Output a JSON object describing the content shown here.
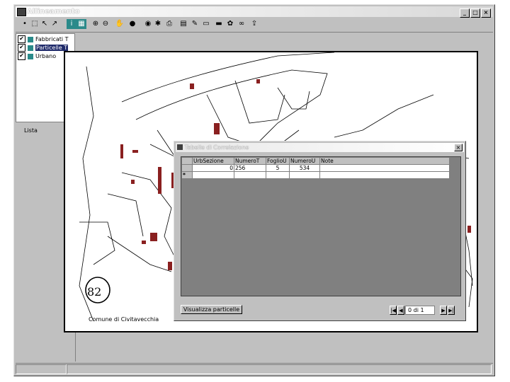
{
  "window": {
    "title": "Allineamento"
  },
  "caption_buttons": [
    "_",
    "□",
    "×"
  ],
  "toolbar": {
    "buttons": [
      {
        "name": "pointer-icon",
        "glyph": "•"
      },
      {
        "name": "zoom-window-icon",
        "glyph": "⬚"
      },
      {
        "name": "select-arrow-icon",
        "glyph": "↖"
      },
      {
        "name": "draw-icon",
        "glyph": "↗"
      },
      {
        "name": "identify-icon",
        "glyph": "i"
      },
      {
        "name": "layer-icon",
        "glyph": "▦"
      },
      {
        "name": "zoom-in-icon",
        "glyph": "⊕"
      },
      {
        "name": "zoom-out-icon",
        "glyph": "⊖"
      },
      {
        "name": "pan-hand-icon",
        "glyph": "✋"
      },
      {
        "name": "record-icon",
        "glyph": "●"
      },
      {
        "name": "globe-icon",
        "glyph": "◉"
      },
      {
        "name": "pin-icon",
        "glyph": "✱"
      },
      {
        "name": "print-icon",
        "glyph": "⎙"
      },
      {
        "name": "table-icon",
        "glyph": "▤"
      },
      {
        "name": "edit-icon",
        "glyph": "✎"
      },
      {
        "name": "map-icon",
        "glyph": "▭"
      },
      {
        "name": "highlight-icon",
        "glyph": "▬"
      },
      {
        "name": "palette-icon",
        "glyph": "✿"
      },
      {
        "name": "binoculars-icon",
        "glyph": "∞"
      },
      {
        "name": "export-icon",
        "glyph": "⇪"
      }
    ]
  },
  "layers": [
    {
      "label": "Fabbricati T",
      "checked": "✔",
      "selected": false
    },
    {
      "label": "Particelle T",
      "checked": "✔",
      "selected": true
    },
    {
      "label": "Urbano",
      "checked": "✔",
      "selected": false
    }
  ],
  "left_panel": {
    "label": "Lista"
  },
  "map": {
    "annotation": "82",
    "caption": "Comune di Civitavecchia"
  },
  "dialog": {
    "title": "Tabelle di Correlazione",
    "columns": [
      "UrbSezione",
      "NumeroT",
      "FoglioU",
      "NumeroU",
      "Note"
    ],
    "rows": [
      {
        "marker": "",
        "cells": [
          "0",
          "256",
          "5",
          "534",
          ""
        ]
      },
      {
        "marker": "*",
        "cells": [
          "",
          "",
          "",
          "",
          ""
        ]
      }
    ],
    "action_button": "Visualizza particelle",
    "record_indicator": "0 di 1",
    "nav": {
      "first": "|◀",
      "prev": "◀",
      "next": "▶",
      "last": "▶|"
    }
  }
}
